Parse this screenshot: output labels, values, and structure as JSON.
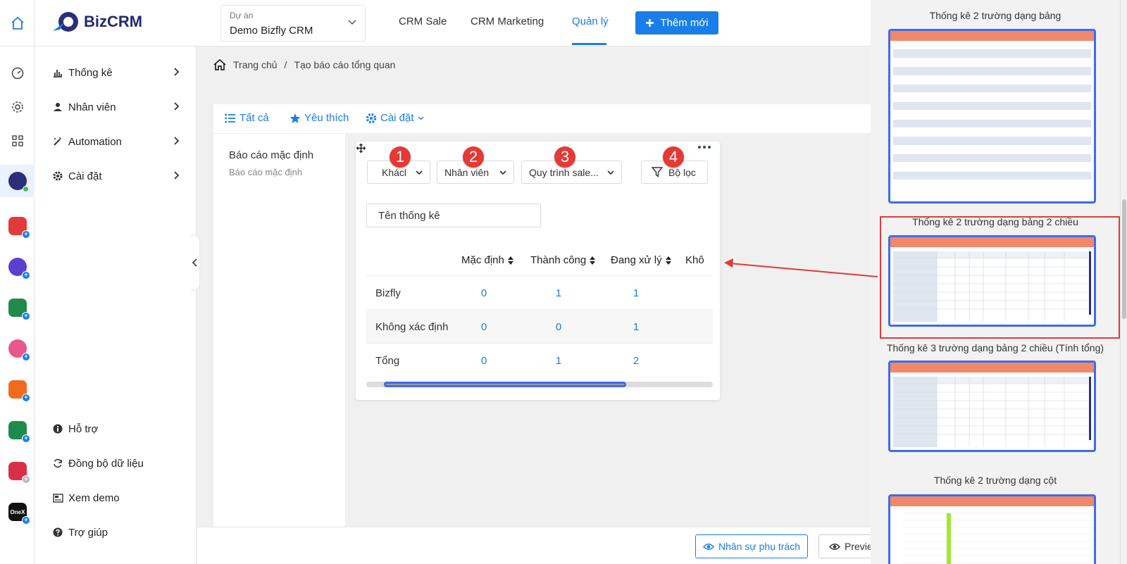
{
  "brand": {
    "name_part1": "Biz",
    "name_part2": "CRM",
    "accent": "#1a7ee8",
    "badge_color": "#e53935"
  },
  "header": {
    "project_label": "Dự án",
    "project_value": "Demo Bizfly CRM",
    "nav": [
      {
        "label": "CRM Sale",
        "active": false
      },
      {
        "label": "CRM Marketing",
        "active": false
      },
      {
        "label": "Quản lý",
        "active": true
      }
    ],
    "add_new_label": "Thêm mới"
  },
  "rail": {
    "icons": [
      "home-icon",
      "dashboard-icon",
      "gear-icon",
      "grid-icon",
      "bizcrm-app-icon",
      "mail-app-icon",
      "bot-app-icon",
      "translate-app-icon",
      "heart-app-icon",
      "shop-app-icon",
      "translate-app-icon-2",
      "mail-app-icon-2",
      "onex-app-icon"
    ],
    "onex_label": "OneX"
  },
  "sidebar": {
    "items": [
      {
        "label": "Thống kê",
        "icon": "bar-chart-icon"
      },
      {
        "label": "Nhân viên",
        "icon": "person-icon"
      },
      {
        "label": "Automation",
        "icon": "magic-wand-icon"
      },
      {
        "label": "Cài đặt",
        "icon": "gear-icon"
      }
    ],
    "bottom_items": [
      {
        "label": "Hỗ trợ",
        "icon": "info-icon"
      },
      {
        "label": "Đồng bộ dữ liệu",
        "icon": "sync-icon"
      },
      {
        "label": "Xem demo",
        "icon": "video-icon"
      },
      {
        "label": "Trợ giúp",
        "icon": "help-icon"
      }
    ]
  },
  "breadcrumb": {
    "home": "Trang chủ",
    "separator": "/",
    "current": "Tạo báo cáo tổng quan"
  },
  "toolbar": {
    "all": "Tất cả",
    "favorite": "Yêu thích",
    "settings": "Cài đặt"
  },
  "report_list": {
    "title": "Báo cáo mặc định",
    "subtitle": "Báo cáo mặc định"
  },
  "widget": {
    "filters": [
      {
        "badge": "1",
        "value": "Khácl"
      },
      {
        "badge": "2",
        "value": "Nhân viên"
      },
      {
        "badge": "3",
        "value": "Quy trình sale..."
      },
      {
        "badge": "4",
        "value": "Bộ lọc"
      }
    ],
    "name_placeholder": "Tên thống kê",
    "columns": [
      "Mặc định",
      "Thành công",
      "Đang xử lý",
      "Khô"
    ],
    "rows": [
      {
        "label": "Bizfly",
        "values": [
          "0",
          "1",
          "1"
        ]
      },
      {
        "label": "Không xác định",
        "values": [
          "0",
          "0",
          "1"
        ]
      },
      {
        "label": "Tổng",
        "values": [
          "0",
          "1",
          "2"
        ]
      }
    ],
    "scroll_fraction": 0.7
  },
  "bottom": {
    "assignee_button": "Nhân sự phụ trách",
    "preview_button": "Previe"
  },
  "templates": [
    {
      "title": "Thống kê 2 trường dạng bảng"
    },
    {
      "title": "Thống kê 2 trường dạng bảng 2 chiều"
    },
    {
      "title": "Thống kê 3 trường dạng bảng 2 chiều (Tính tổng)"
    },
    {
      "title": "Thống kê 2 trường dạng cột"
    }
  ]
}
